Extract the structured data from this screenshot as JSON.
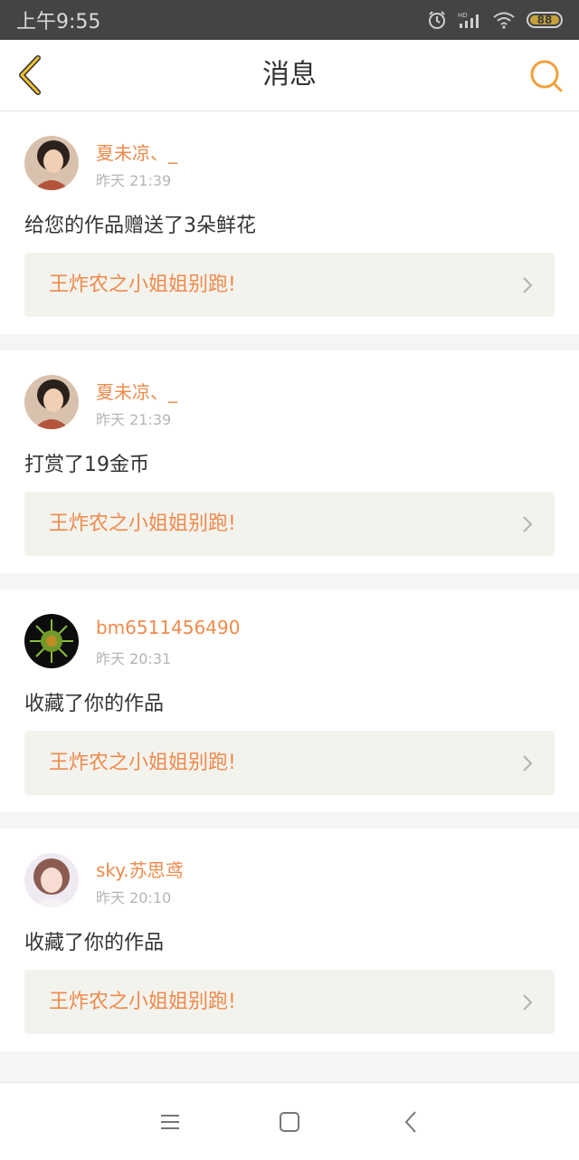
{
  "status_bar": {
    "time": "上午9:55",
    "battery": "88",
    "icons": [
      "alarm-icon",
      "hd-signal-icon",
      "wifi-icon",
      "battery-icon"
    ]
  },
  "header": {
    "title": "消息",
    "back_icon": "chevron-left-icon",
    "search_icon": "search-icon",
    "accent_color": "#f2a03c"
  },
  "messages": [
    {
      "username": "夏未凉、_",
      "time": "昨天 21:39",
      "action": "给您的作品赠送了3朵鲜花",
      "work_title": "王炸农之小姐姐别跑!"
    },
    {
      "username": "夏未凉、_",
      "time": "昨天 21:39",
      "action": "打赏了19金币",
      "work_title": "王炸农之小姐姐别跑!"
    },
    {
      "username": "bm6511456490",
      "time": "昨天 20:31",
      "action": "收藏了你的作品",
      "work_title": "王炸农之小姐姐别跑!"
    },
    {
      "username": "sky.苏思鸢",
      "time": "昨天 20:10",
      "action": "收藏了你的作品",
      "work_title": "王炸农之小姐姐别跑!"
    }
  ],
  "colors": {
    "username": "#f08a4b",
    "link_bg": "#f3f3ee",
    "status_bar_bg": "#444444"
  },
  "nav_bar": [
    "menu-icon",
    "home-icon",
    "back-icon"
  ]
}
